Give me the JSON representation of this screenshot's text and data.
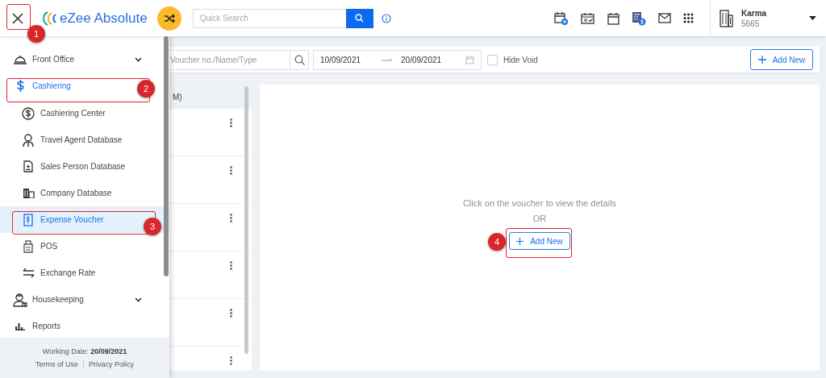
{
  "header": {
    "logo": "eZee Absolute",
    "search": {
      "placeholder": "Quick Search"
    },
    "user": {
      "name": "Karma",
      "code": "5665"
    }
  },
  "sidebar": {
    "items": [
      {
        "kind": "group",
        "label": "Front Office",
        "selected": false
      },
      {
        "kind": "section",
        "label": "Cashiering",
        "selected": true,
        "children": [
          {
            "label": "Cashiering Center",
            "selected": false
          },
          {
            "label": "Travel Agent Database",
            "selected": false
          },
          {
            "label": "Sales Person Database",
            "selected": false
          },
          {
            "label": "Company Database",
            "selected": false
          },
          {
            "label": "Expense Voucher",
            "selected": true
          },
          {
            "label": "POS",
            "selected": false
          },
          {
            "label": "Exchange Rate",
            "selected": false
          }
        ]
      },
      {
        "kind": "group",
        "label": "Housekeeping",
        "selected": false
      },
      {
        "kind": "link",
        "label": "Reports",
        "selected": false
      }
    ],
    "footer": {
      "working_date": "Working Date: **20/09/2021**",
      "links": [
        "Terms of Use",
        "Privacy Policy"
      ]
    }
  },
  "toolbar": {
    "search": {
      "placeholder": "Voucher no./Name/Type"
    },
    "date_from": "10/09/2021",
    "date_to": "20/09/2021",
    "hide_void": {
      "label": "Hide Void",
      "checked": false
    },
    "add_button": "Add New"
  },
  "list": {
    "header": "M)"
  },
  "detail": {
    "message": "Click on the voucher to view the details",
    "or": "OR",
    "add_button": "Add New"
  },
  "annotations": [
    {
      "number": "1"
    },
    {
      "number": "2"
    },
    {
      "number": "3"
    },
    {
      "number": "4"
    }
  ]
}
